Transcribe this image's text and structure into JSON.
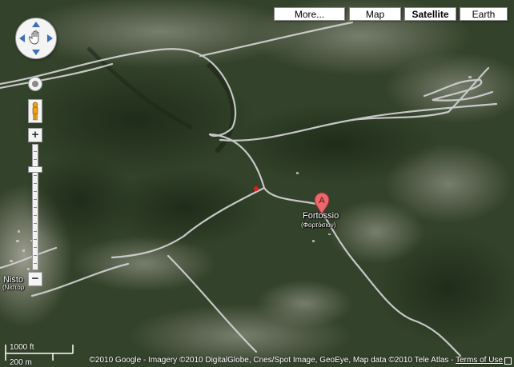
{
  "map_type_buttons": {
    "more": "More...",
    "map": "Map",
    "satellite": "Satellite",
    "earth": "Earth"
  },
  "active_map_type": "Satellite",
  "place_labels": {
    "marker_letter": "A",
    "town": "Fortossio",
    "town_greek": "(Φορτόσιον)",
    "west_town": "Nisto",
    "west_town_greek": "(Νίστορ"
  },
  "scale": {
    "imperial": "1000 ft",
    "metric": "200 m"
  },
  "attribution": {
    "text": "©2010 Google - Imagery ©2010 DigitalGlobe, Cnes/Spot Image, GeoEye, Map data ©2010 Tele Atlas - ",
    "terms": "Terms of Use"
  },
  "colors": {
    "marker": "#e8696b",
    "road": "#c9c9c9",
    "forest": "#2b3a24",
    "clearing": "#8a8b7a"
  }
}
